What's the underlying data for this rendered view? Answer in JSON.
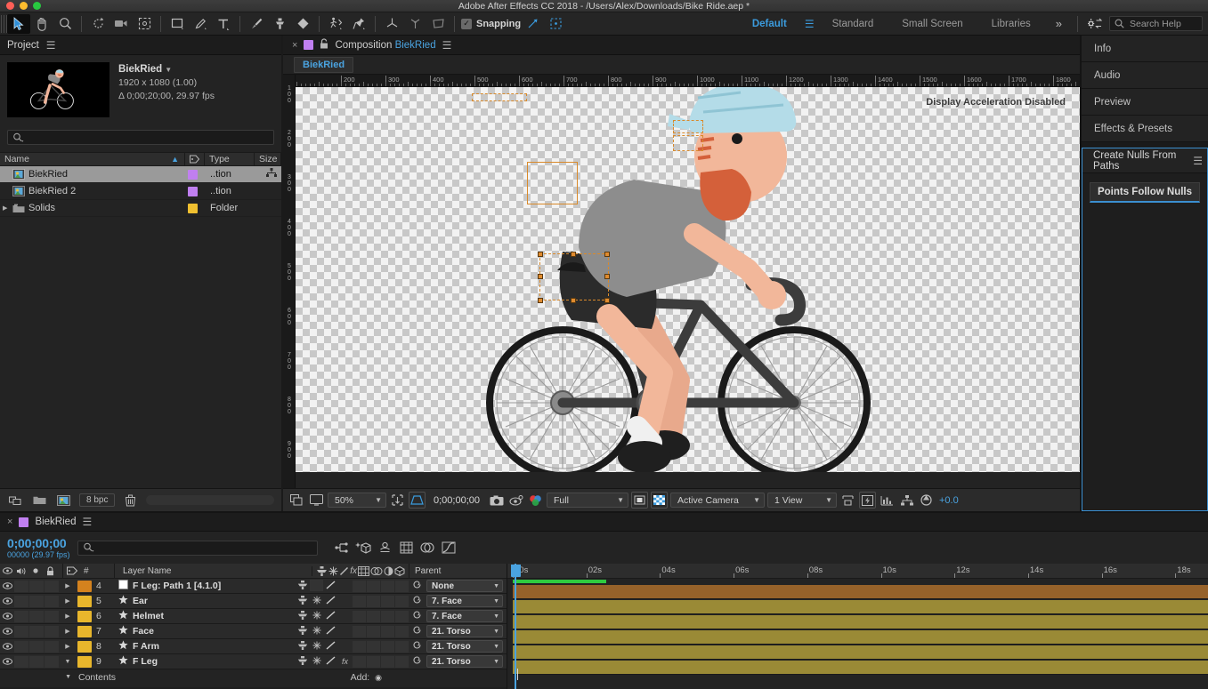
{
  "window": {
    "title": "Adobe After Effects CC 2018 - /Users/Alex/Downloads/Bike Ride.aep *"
  },
  "toolbar": {
    "snapping_label": "Snapping",
    "snapping_checked": "✓",
    "workspaces": [
      {
        "label": "Default",
        "active": true
      },
      {
        "label": "Standard",
        "active": false
      },
      {
        "label": "Small Screen",
        "active": false
      },
      {
        "label": "Libraries",
        "active": false
      }
    ],
    "more_label": "»",
    "search_help_placeholder": "Search Help"
  },
  "project": {
    "panel_title": "Project",
    "comp_name": "BiekRied",
    "comp_dimensions": "1920 x 1080 (1.00)",
    "comp_duration": "Δ 0;00;20;00, 29.97 fps",
    "search_placeholder": "",
    "columns": [
      "Name",
      "Type",
      "Size"
    ],
    "items": [
      {
        "name": "BiekRied",
        "type": "..tion",
        "color": "#c07ff0",
        "kind": "comp",
        "selected": true
      },
      {
        "name": "BiekRied 2",
        "type": "..tion",
        "color": "#c07ff0",
        "kind": "comp",
        "selected": false
      },
      {
        "name": "Solids",
        "type": "Folder",
        "color": "#f0c030",
        "kind": "folder",
        "selected": false
      }
    ],
    "bit_depth": "8 bpc"
  },
  "composition": {
    "tab_label": "Composition",
    "tab_name": "BiekRied",
    "subtab_label": "BiekRied",
    "overlay_message": "Display Acceleration Disabled",
    "h_ruler_ticks": [
      "200",
      "300",
      "400",
      "500",
      "600",
      "700",
      "800",
      "900",
      "1000",
      "1100",
      "1200",
      "1300",
      "1400",
      "1500",
      "1600",
      "1700",
      "1800"
    ],
    "v_ruler_ticks": [
      "100",
      "200",
      "300",
      "400",
      "500",
      "600",
      "700",
      "800",
      "900"
    ],
    "bottom_bar": {
      "zoom": "50%",
      "timecode": "0;00;00;00",
      "resolution": "Full",
      "camera": "Active Camera",
      "views": "1 View",
      "exposure": "+0.0"
    }
  },
  "right_panels": {
    "items": [
      {
        "label": "Info"
      },
      {
        "label": "Audio"
      },
      {
        "label": "Preview"
      },
      {
        "label": "Effects & Presets"
      }
    ],
    "active_panel": "Create Nulls From Paths",
    "active_button": "Points Follow Nulls"
  },
  "timeline": {
    "tab_name": "BiekRied",
    "current_time": "0;00;00;00",
    "frame_info": "00000 (29.97 fps)",
    "search_placeholder": "",
    "columns": [
      "#",
      "Layer Name",
      "Parent"
    ],
    "time_ticks": [
      "00s",
      "02s",
      "04s",
      "06s",
      "08s",
      "10s",
      "12s",
      "14s",
      "16s",
      "18s"
    ],
    "add_label": "Add:",
    "contents_label": "Contents",
    "layers": [
      {
        "index": "4",
        "name": "F Leg: Path 1 [4.1.0]",
        "parent": "None",
        "color": "#d4821e",
        "bar_color": "#96622a",
        "icon": "path",
        "expanded": false,
        "has_fx": false
      },
      {
        "index": "5",
        "name": "Ear",
        "parent": "7. Face",
        "color": "#e8b62c",
        "bar_color": "#9a8a36",
        "icon": "star",
        "expanded": false,
        "has_fx": false
      },
      {
        "index": "6",
        "name": "Helmet",
        "parent": "7. Face",
        "color": "#e8b62c",
        "bar_color": "#9a8a36",
        "icon": "star",
        "expanded": false,
        "has_fx": false
      },
      {
        "index": "7",
        "name": "Face",
        "parent": "21. Torso",
        "color": "#e8b62c",
        "bar_color": "#9a8a36",
        "icon": "star",
        "expanded": false,
        "has_fx": false
      },
      {
        "index": "8",
        "name": "F Arm",
        "parent": "21. Torso",
        "color": "#e8b62c",
        "bar_color": "#9a8a36",
        "icon": "star",
        "expanded": false,
        "has_fx": false
      },
      {
        "index": "9",
        "name": "F Leg",
        "parent": "21. Torso",
        "color": "#e8b62c",
        "bar_color": "#9a8a36",
        "icon": "star",
        "expanded": true,
        "has_fx": true
      }
    ]
  },
  "colors": {
    "accent": "#4aa3e0",
    "selection_orange": "#d98a2b",
    "render_green": "#2ecc3f"
  }
}
